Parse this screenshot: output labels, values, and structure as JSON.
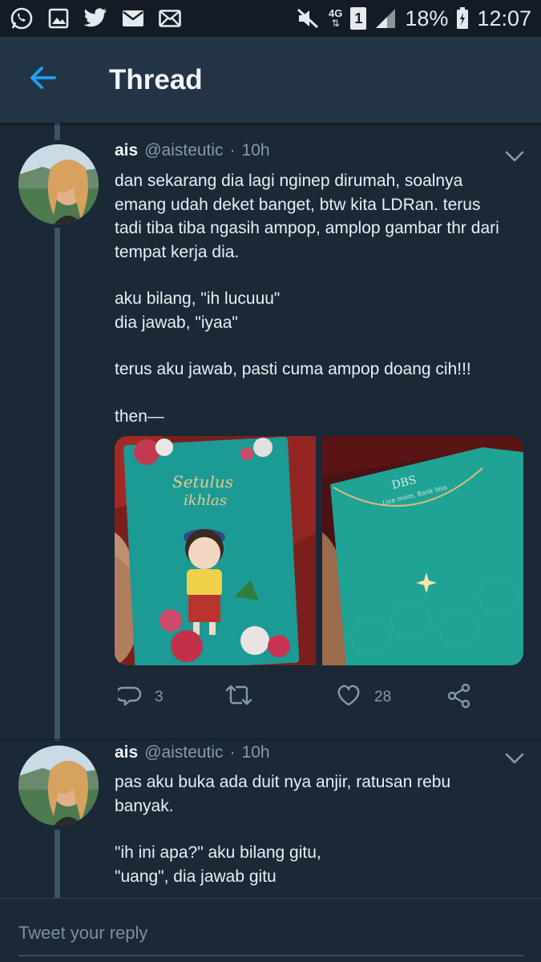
{
  "status_bar": {
    "left_icons": [
      "whatsapp-icon",
      "gallery-icon",
      "twitter-icon",
      "email-icon",
      "message-icon"
    ],
    "network": "4G",
    "sim": "1",
    "battery": "18%",
    "time": "12:07"
  },
  "header": {
    "title": "Thread",
    "accent": "#1da1f2"
  },
  "tweets": [
    {
      "name": "ais",
      "handle": "@aisteutic",
      "dot": "·",
      "time": "10h",
      "paragraphs": [
        "dan sekarang dia lagi nginep dirumah, soalnya\nemang udah deket banget, btw kita LDRan. terus\ntadi tiba tiba ngasih ampop, amplop gambar thr dari\ntempat kerja dia.",
        "aku bilang, \"ih lucuuu\"\ndia jawab, \"iyaa\"",
        "terus aku jawab, pasti cuma ampop doang cih!!!",
        "then—"
      ],
      "media": [
        {
          "caption_top": "Setulus",
          "caption_bottom": "ikhlas"
        },
        {
          "brand": "DBS",
          "tagline": "Live more, Bank less"
        }
      ],
      "reply_count": "3",
      "retweet_count": "",
      "like_count": "28"
    },
    {
      "name": "ais",
      "handle": "@aisteutic",
      "dot": "·",
      "time": "10h",
      "paragraphs": [
        "pas aku buka ada duit nya anjir, ratusan rebu\nbanyak.",
        "\"ih ini apa?\" aku bilang gitu,\n\"uang\", dia jawab gitu"
      ]
    }
  ],
  "reply_bar": {
    "placeholder": "Tweet your reply"
  }
}
